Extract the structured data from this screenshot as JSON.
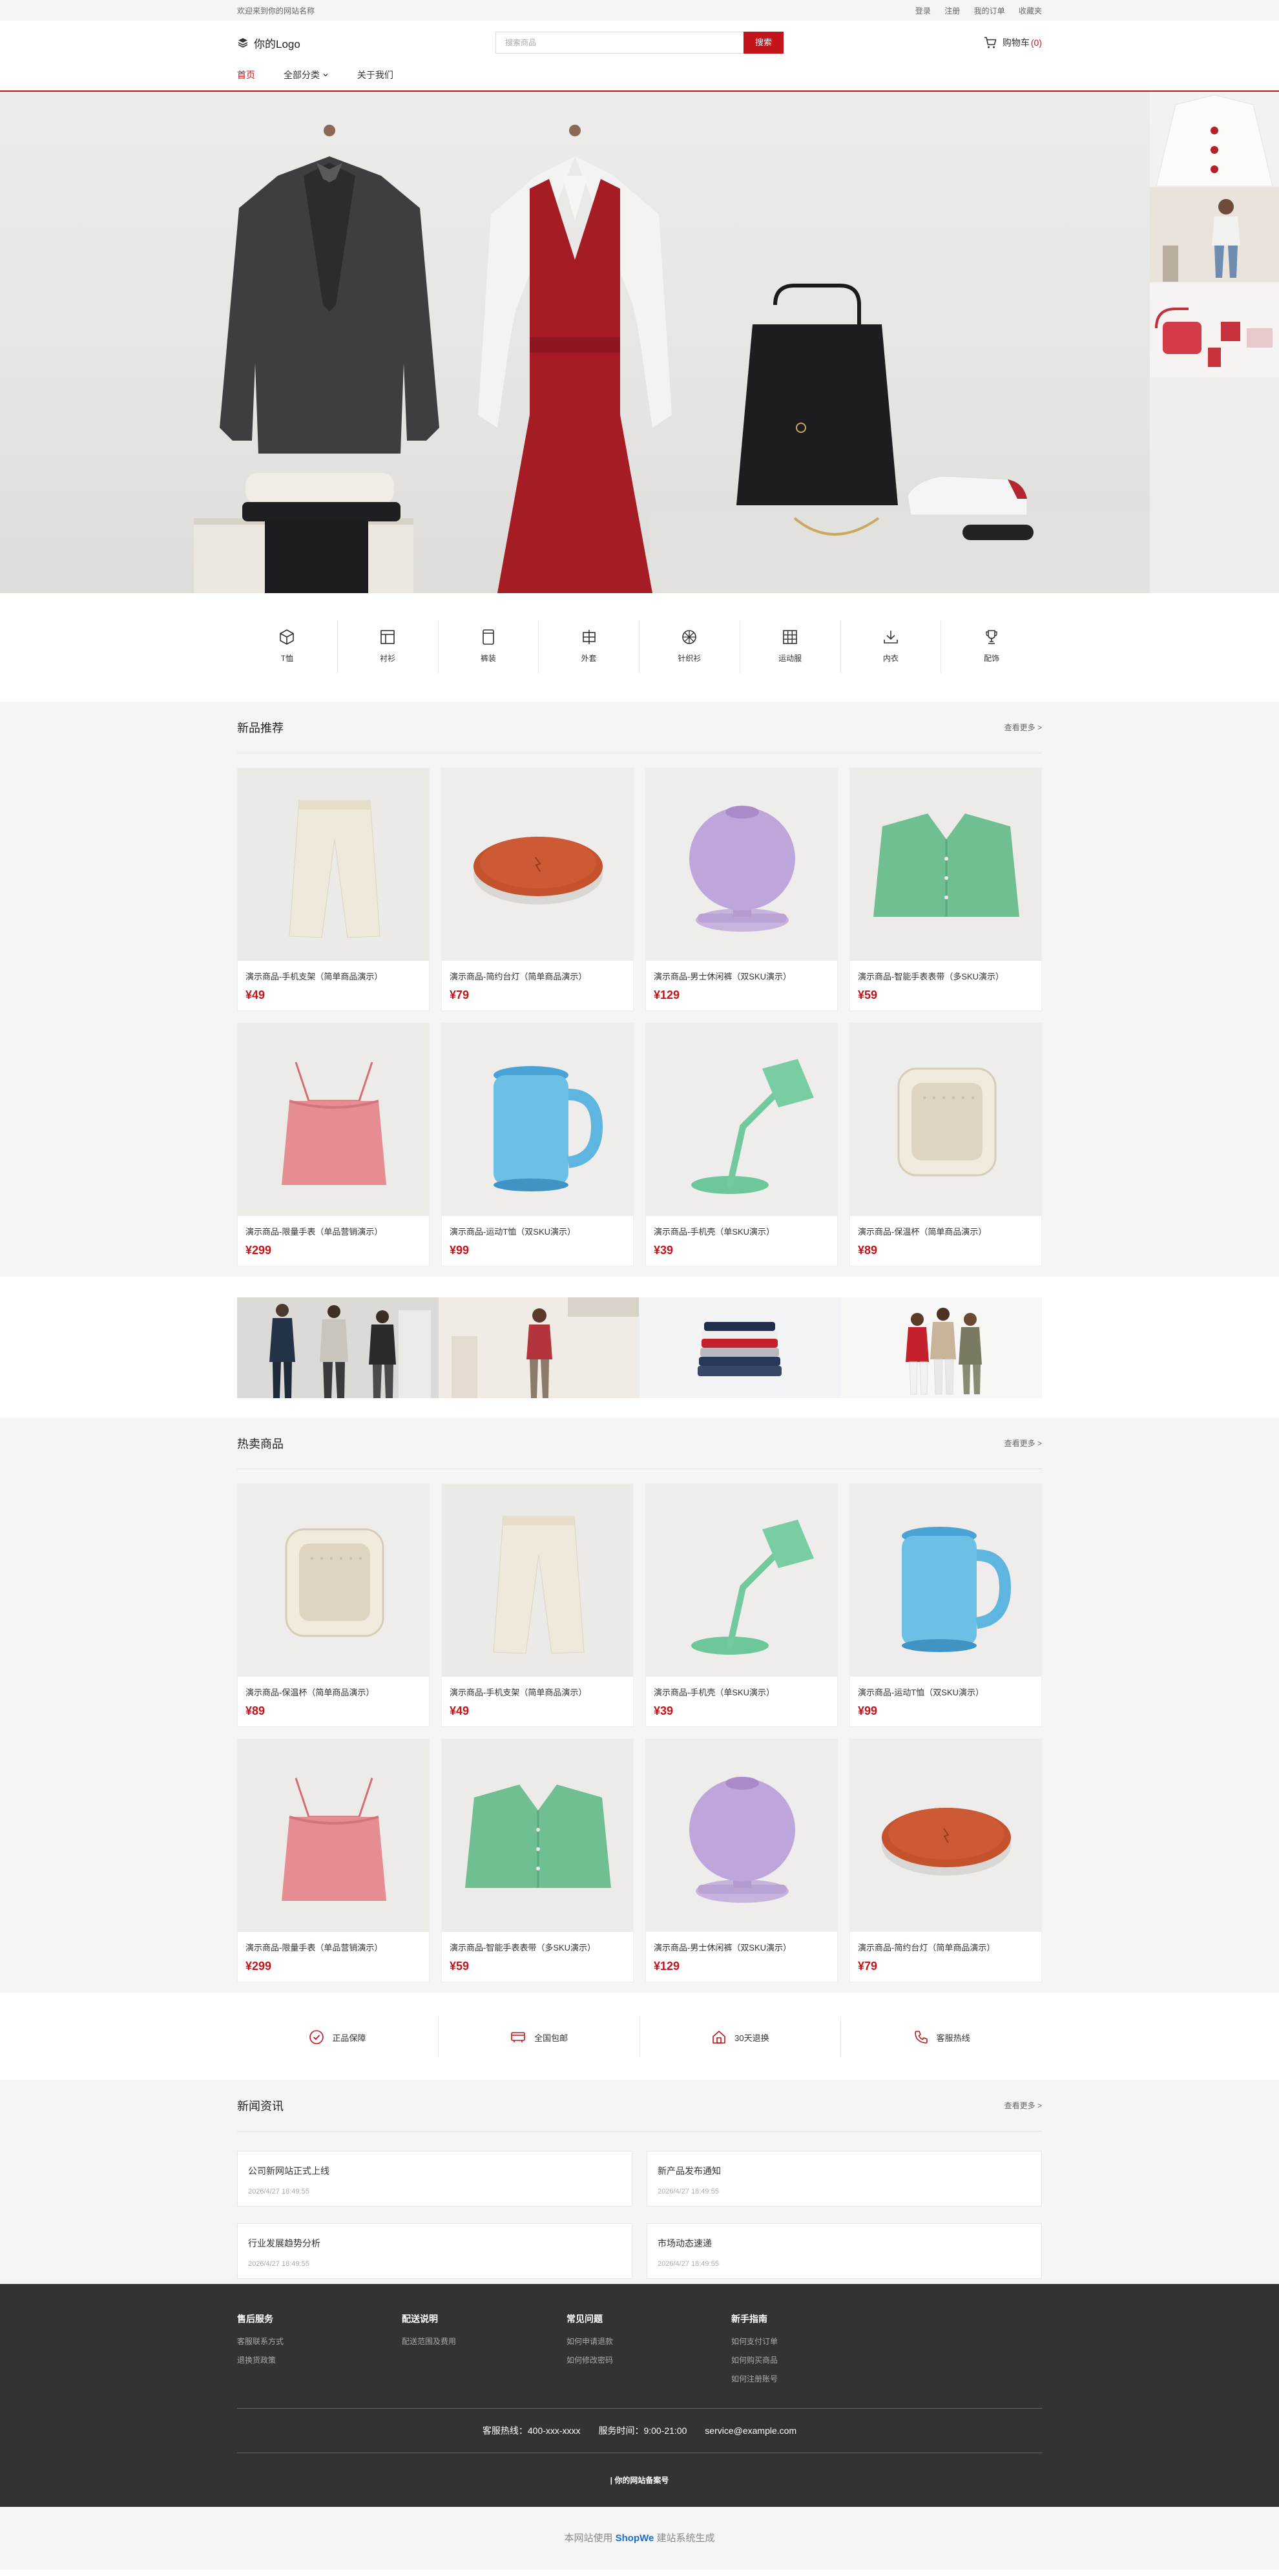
{
  "topbar": {
    "welcome": "欢迎来到你的网站名称",
    "links": [
      "登录",
      "注册",
      "我的订单",
      "收藏夹"
    ]
  },
  "header": {
    "logo": "你的Logo",
    "search_placeholder": "搜索商品",
    "search_button": "搜索",
    "cart_label": "购物车",
    "cart_count": "(0)"
  },
  "nav": {
    "items": [
      "首页",
      "全部分类",
      "关于我们"
    ]
  },
  "categories": [
    {
      "label": "T恤",
      "icon": "box-icon"
    },
    {
      "label": "衬衫",
      "icon": "layout-icon"
    },
    {
      "label": "裤装",
      "icon": "card-icon"
    },
    {
      "label": "外套",
      "icon": "grid-cross-icon"
    },
    {
      "label": "针织衫",
      "icon": "aperture-icon"
    },
    {
      "label": "运动服",
      "icon": "grid-icon"
    },
    {
      "label": "内衣",
      "icon": "download-icon"
    },
    {
      "label": "配饰",
      "icon": "trophy-icon"
    }
  ],
  "new_products": {
    "title": "新品推荐",
    "more": "查看更多 >",
    "items": [
      {
        "name": "演示商品-手机支架（简单商品演示）",
        "price": "¥49",
        "img": "pants"
      },
      {
        "name": "演示商品-简约台灯（简单商品演示）",
        "price": "¥79",
        "img": "charger"
      },
      {
        "name": "演示商品-男士休闲裤（双SKU演示）",
        "price": "¥129",
        "img": "speaker"
      },
      {
        "name": "演示商品-智能手表表带（多SKU演示）",
        "price": "¥59",
        "img": "cardigan"
      },
      {
        "name": "演示商品-限量手表（单品营销演示）",
        "price": "¥299",
        "img": "top"
      },
      {
        "name": "演示商品-运动T恤（双SKU演示）",
        "price": "¥99",
        "img": "kettle"
      },
      {
        "name": "演示商品-手机壳（单SKU演示）",
        "price": "¥39",
        "img": "lamp"
      },
      {
        "name": "演示商品-保温杯（简单商品演示）",
        "price": "¥89",
        "img": "box"
      }
    ]
  },
  "hot_products": {
    "title": "热卖商品",
    "more": "查看更多 >",
    "items": [
      {
        "name": "演示商品-保温杯（简单商品演示）",
        "price": "¥89",
        "img": "box"
      },
      {
        "name": "演示商品-手机支架（简单商品演示）",
        "price": "¥49",
        "img": "pants"
      },
      {
        "name": "演示商品-手机壳（单SKU演示）",
        "price": "¥39",
        "img": "lamp"
      },
      {
        "name": "演示商品-运动T恤（双SKU演示）",
        "price": "¥99",
        "img": "kettle"
      },
      {
        "name": "演示商品-限量手表（单品营销演示）",
        "price": "¥299",
        "img": "top"
      },
      {
        "name": "演示商品-智能手表表带（多SKU演示）",
        "price": "¥59",
        "img": "cardigan"
      },
      {
        "name": "演示商品-男士休闲裤（双SKU演示）",
        "price": "¥129",
        "img": "speaker"
      },
      {
        "name": "演示商品-简约台灯（简单商品演示）",
        "price": "¥79",
        "img": "charger"
      }
    ]
  },
  "features": [
    {
      "label": "正品保障",
      "icon": "check-circle-icon"
    },
    {
      "label": "全国包邮",
      "icon": "truck-icon"
    },
    {
      "label": "30天退换",
      "icon": "home-icon"
    },
    {
      "label": "客服热线",
      "icon": "phone-icon"
    }
  ],
  "news": {
    "title": "新闻资讯",
    "more": "查看更多 >",
    "items": [
      {
        "title": "公司新网站正式上线",
        "date": "2026/4/27 18:49:55"
      },
      {
        "title": "新产品发布通知",
        "date": "2026/4/27 18:49:55"
      },
      {
        "title": "行业发展趋势分析",
        "date": "2026/4/27 18:49:55"
      },
      {
        "title": "市场动态速递",
        "date": "2026/4/27 18:49:55"
      }
    ]
  },
  "footer": {
    "columns": [
      {
        "heading": "售后服务",
        "links": [
          "客服联系方式",
          "退换货政策"
        ]
      },
      {
        "heading": "配送说明",
        "links": [
          "配送范围及费用"
        ]
      },
      {
        "heading": "常见问题",
        "links": [
          "如何申请退款",
          "如何修改密码"
        ]
      },
      {
        "heading": "新手指南",
        "links": [
          "如何支付订单",
          "如何购买商品",
          "如何注册账号"
        ]
      }
    ],
    "hotline": "客服热线：400-xxx-xxxx",
    "hours": "服务时间：9:00-21:00",
    "email": "service@example.com",
    "beian": "| 你的网站备案号"
  },
  "powered": {
    "prefix": "本网站使用",
    "brand": "ShopWe",
    "suffix": "建站系统生成"
  },
  "colors": {
    "brand_red": "#c4141b",
    "footer_bg": "#333333",
    "link_blue": "#1e6ec8"
  }
}
